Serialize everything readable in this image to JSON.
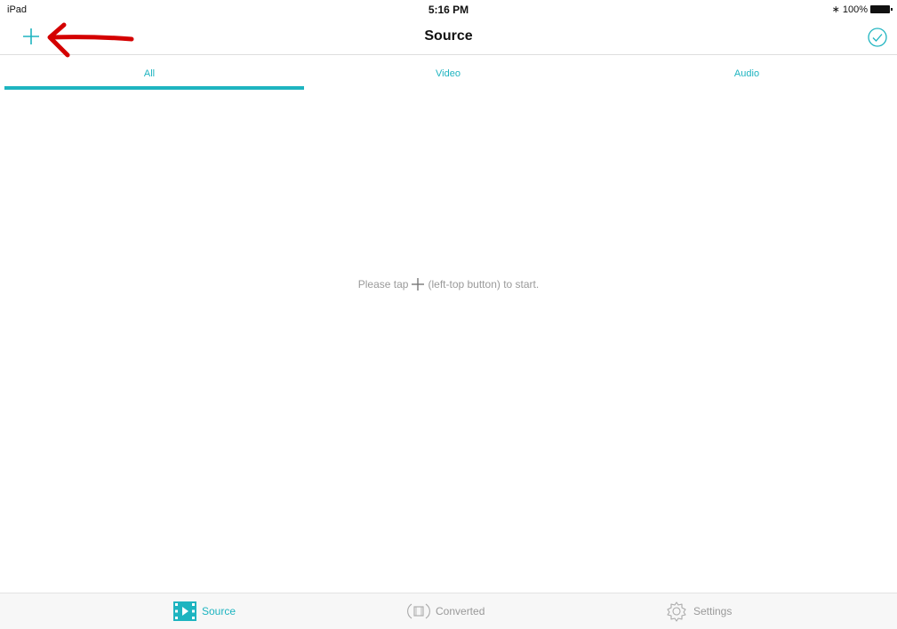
{
  "status_bar": {
    "device": "iPad",
    "time": "5:16 PM",
    "battery": "100%"
  },
  "nav": {
    "title": "Source",
    "add_icon": "plus-icon",
    "done_icon": "checkmark-circle-icon"
  },
  "tabs": [
    {
      "label": "All",
      "active": true
    },
    {
      "label": "Video",
      "active": false
    },
    {
      "label": "Audio",
      "active": false
    }
  ],
  "empty_state": {
    "prefix": "Please tap",
    "suffix": "(left-top button) to start."
  },
  "tab_bar": [
    {
      "label": "Source",
      "icon": "film-icon",
      "active": true
    },
    {
      "label": "Converted",
      "icon": "converted-film-icon",
      "active": false
    },
    {
      "label": "Settings",
      "icon": "gear-icon",
      "active": false
    }
  ],
  "colors": {
    "accent": "#1eb4c0",
    "annotation": "#d40000",
    "inactive": "#999999"
  }
}
